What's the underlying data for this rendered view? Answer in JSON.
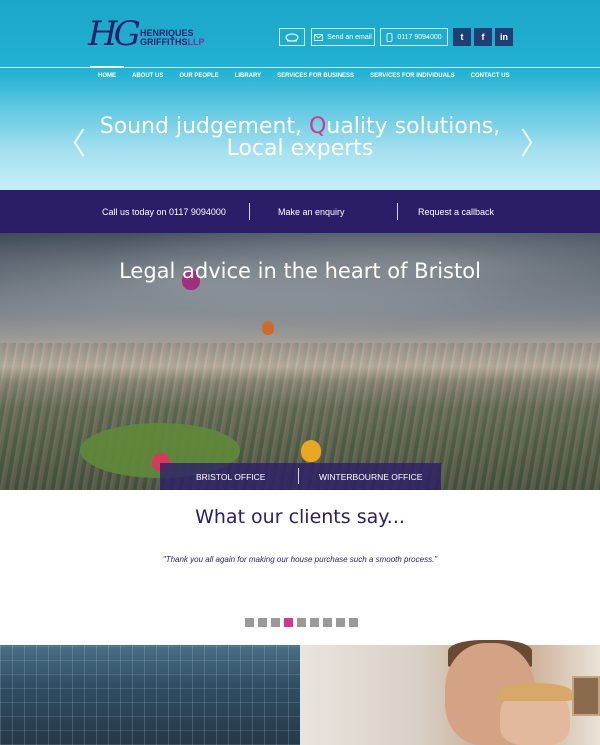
{
  "brand": {
    "mark": "HG",
    "line1": "HENRIQUES",
    "line2": "GRIFFITHS",
    "suffix": "LLP"
  },
  "header_actions": {
    "email_label": "Send an email",
    "phone_label": "0117 9094000",
    "twitter": "t",
    "facebook": "f",
    "linkedin": "in"
  },
  "nav": {
    "items": [
      {
        "label": "HOME"
      },
      {
        "label": "ABOUT US"
      },
      {
        "label": "OUR PEOPLE"
      },
      {
        "label": "LIBRARY"
      },
      {
        "label": "SERVICES FOR BUSINESS"
      },
      {
        "label": "SERVICES FOR INDIVIDUALS"
      },
      {
        "label": "CONTACT US"
      }
    ]
  },
  "slider": {
    "line1_a": "Sound judgement, ",
    "line1_q": "Q",
    "line1_b": "uality solutions,",
    "line2": "Local experts",
    "prev": "〈",
    "next": "〉"
  },
  "cta": {
    "call": "Call us today on 0117 9094000",
    "enquiry": "Make an enquiry",
    "callback": "Request a callback"
  },
  "hero": {
    "title": "Legal advice in the heart of Bristol",
    "office1": "BRISTOL OFFICE",
    "office2": "WINTERBOURNE OFFICE"
  },
  "testimonials": {
    "title": "What our clients say...",
    "quote": "\"Thank you all again for making our house purchase such a smooth process.\"",
    "active_index": 3,
    "count": 9
  },
  "colors": {
    "brand_navy": "#2b1d68",
    "accent_pink": "#d2378f",
    "header_teal": "#1aa6c8"
  }
}
